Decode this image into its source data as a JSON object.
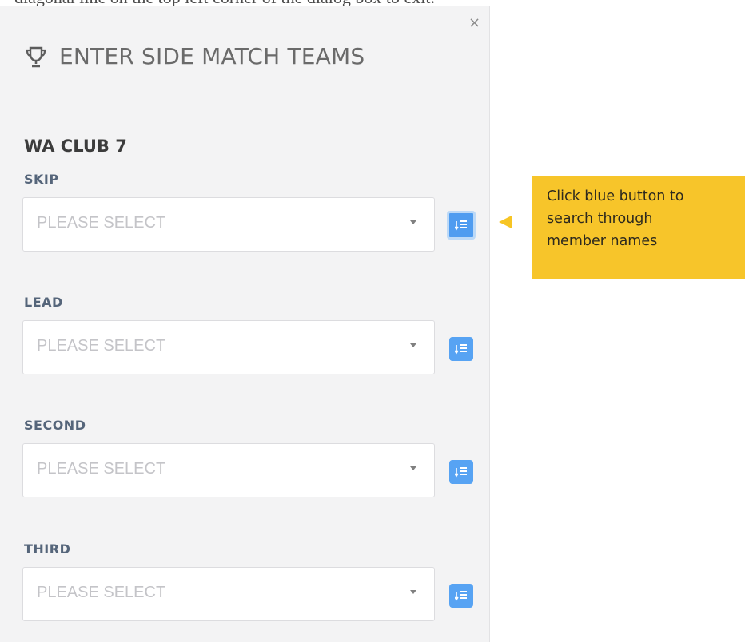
{
  "top_cut_text": "diagonal line on the top left corner of the dialog box to exit.",
  "dialog": {
    "title": "ENTER SIDE MATCH TEAMS",
    "close_label": "×",
    "club_name": "WA CLUB 7",
    "fields": [
      {
        "label": "SKIP",
        "placeholder": "PLEASE SELECT"
      },
      {
        "label": "LEAD",
        "placeholder": "PLEASE SELECT"
      },
      {
        "label": "SECOND",
        "placeholder": "PLEASE SELECT"
      },
      {
        "label": "THIRD",
        "placeholder": "PLEASE SELECT"
      }
    ]
  },
  "callout": {
    "lines": [
      "Click blue button to",
      "search through",
      "member names"
    ]
  },
  "colors": {
    "panel_bg": "#f3f3f4",
    "accent_blue": "#57a3f3",
    "callout_yellow": "#f7c52a",
    "label_color": "#55657a"
  },
  "icons": {
    "title": "trophy-icon",
    "close": "close-icon",
    "search_button": "member-search-icon",
    "dropdown": "caret-down-icon"
  }
}
